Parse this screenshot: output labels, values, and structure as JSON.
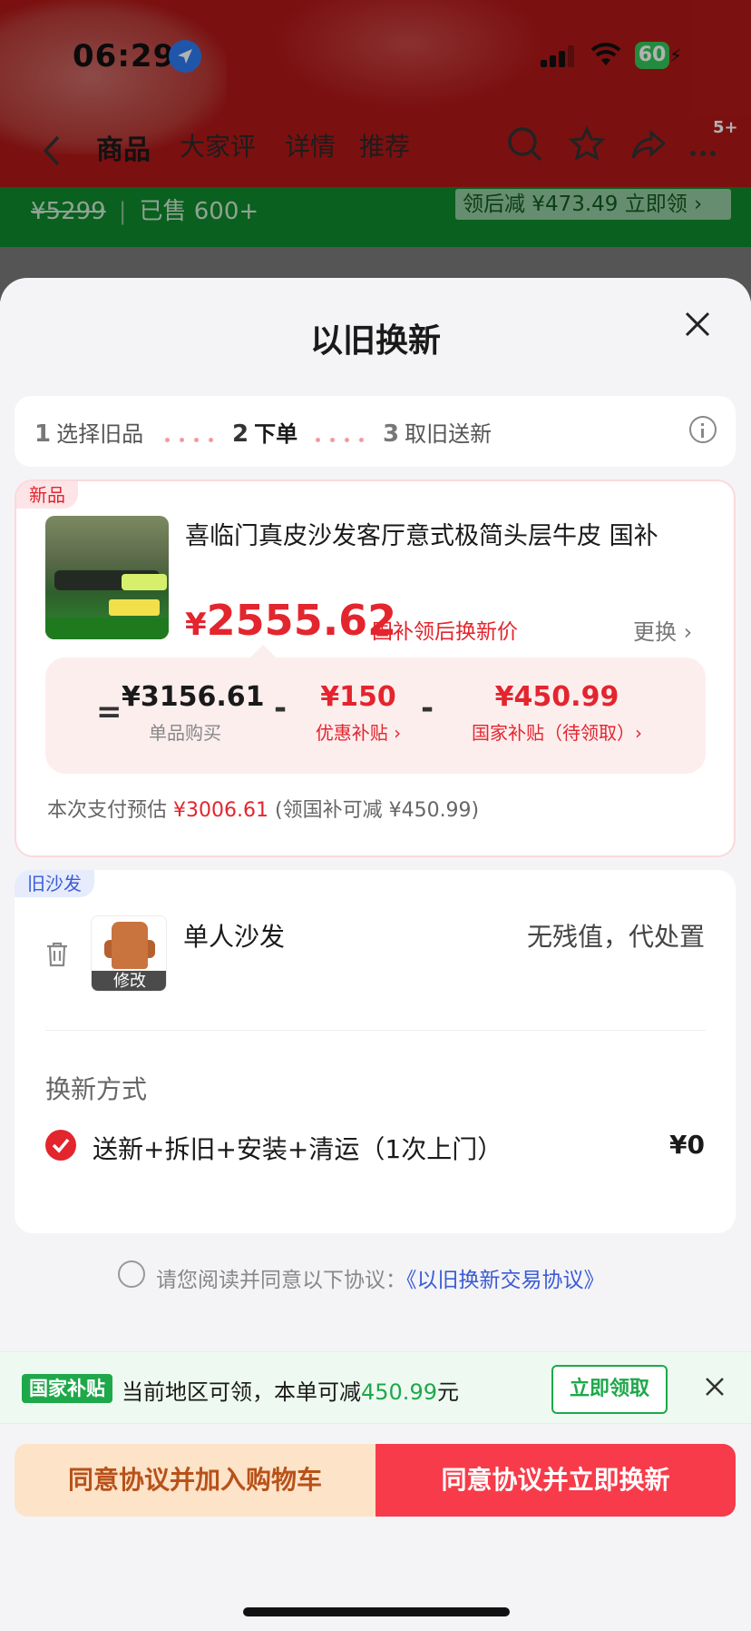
{
  "status_bar": {
    "time": "06:29",
    "battery": "60"
  },
  "background_page": {
    "nav_tabs": [
      "商品",
      "大家评",
      "详情",
      "推荐"
    ],
    "nav_badge": "5+",
    "old_price": "¥5299",
    "sold": "已售 600+",
    "coupon": "领后减 ¥473.49 立即领 ›"
  },
  "sheet": {
    "title": "以旧换新",
    "steps": [
      {
        "num": "1",
        "label": "选择旧品"
      },
      {
        "num": "2",
        "label": "下单"
      },
      {
        "num": "3",
        "label": "取旧送新"
      }
    ],
    "new_item": {
      "tag": "新品",
      "title": "喜临门真皮沙发客厅意式极简头层牛皮 国补",
      "price_symbol": "¥",
      "price": "2555.62",
      "price_note": "国补领后换新价",
      "change_label": "更换 ›",
      "calc": {
        "equals": "=",
        "minus": "-",
        "base_value": "¥3156.61",
        "base_label": "单品购买",
        "discount_value": "¥150",
        "discount_label": "优惠补贴 ›",
        "subsidy_value": "¥450.99",
        "subsidy_label": "国家补贴（待领取）›"
      },
      "pay_prefix": "本次支付预估",
      "pay_amount": "¥3006.61",
      "pay_suffix": "(领国补可减 ¥450.99)"
    },
    "old_item": {
      "tag": "旧沙发",
      "name": "单人沙发",
      "modify_label": "修改",
      "value_text": "无残值，代处置",
      "method_title": "换新方式",
      "method_text": "送新+拆旧+安装+清运（1次上门）",
      "method_price": "¥0"
    },
    "agreement": {
      "prefix": "请您阅读并同意以下协议：",
      "link": "《以旧换新交易协议》"
    },
    "subsidy_bar": {
      "badge": "国家补贴",
      "text_before": "当前地区可领，本单可减",
      "amount": "450.99",
      "text_after": "元",
      "button": "立即领取"
    },
    "buttons": {
      "cart": "同意协议并加入购物车",
      "buy": "同意协议并立即换新"
    }
  },
  "colors": {
    "accent_red": "#e3252e",
    "subsidy_green": "#1ea84a",
    "link_blue": "#3b5bd6"
  }
}
